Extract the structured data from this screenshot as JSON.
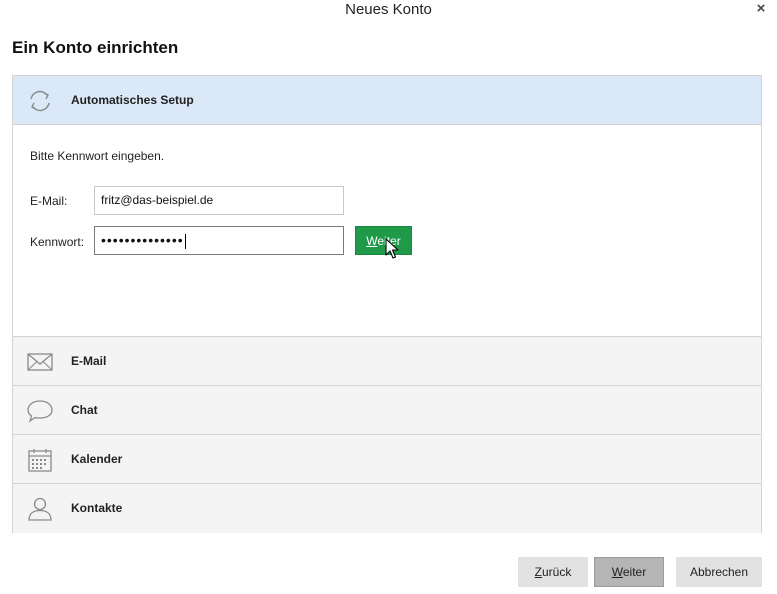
{
  "window": {
    "title": "Neues Konto",
    "close_symbol": "×"
  },
  "heading": "Ein Konto einrichten",
  "sections": {
    "setup": {
      "label": "Automatisches Setup",
      "icon": "refresh-icon"
    },
    "email": {
      "label": "E-Mail",
      "icon": "envelope-icon"
    },
    "chat": {
      "label": "Chat",
      "icon": "speech-bubble-icon"
    },
    "calendar": {
      "label": "Kalender",
      "icon": "calendar-icon"
    },
    "contacts": {
      "label": "Kontakte",
      "icon": "person-icon"
    }
  },
  "setup_form": {
    "prompt": "Bitte Kennwort eingeben.",
    "email_label": "E-Mail:",
    "email_value": "fritz@das-beispiel.de",
    "password_label": "Kennwort:",
    "password_mask": "••••••••••••••",
    "go_button": {
      "accesskey": "W",
      "rest": "eiter"
    }
  },
  "footer": {
    "back": {
      "accesskey": "Z",
      "rest": "urück"
    },
    "next": {
      "accesskey": "W",
      "rest": "eiter"
    },
    "cancel": "Abbrechen"
  },
  "colors": {
    "active_header": "#dae8f8",
    "go_button": "#1f9a48",
    "section_bg": "#f4f4f4"
  }
}
